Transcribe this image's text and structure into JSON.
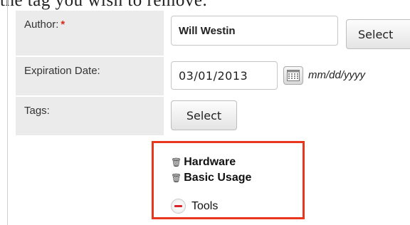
{
  "intro_text": "the tag you wish to remove.",
  "form": {
    "author": {
      "label": "Author:",
      "required_mark": "*",
      "value": "Will Westin",
      "select_label": "Select"
    },
    "expiration_date": {
      "label": "Expiration Date:",
      "value": "03/01/2013",
      "format_hint": "mm/dd/yyyy",
      "calendar_icon": "calendar-icon"
    },
    "tags": {
      "label": "Tags:",
      "select_label": "Select",
      "items": [
        {
          "name": "Hardware",
          "icon": "trash-icon"
        },
        {
          "name": "Basic Usage",
          "icon": "trash-icon"
        }
      ],
      "removed_item": {
        "name": "Tools",
        "icon": "minus-circle-icon"
      }
    }
  },
  "colors": {
    "highlight_border": "#e8361f",
    "required_mark": "#d92b1a",
    "remove_minus": "#d8232a",
    "label_background": "#ebebeb"
  }
}
